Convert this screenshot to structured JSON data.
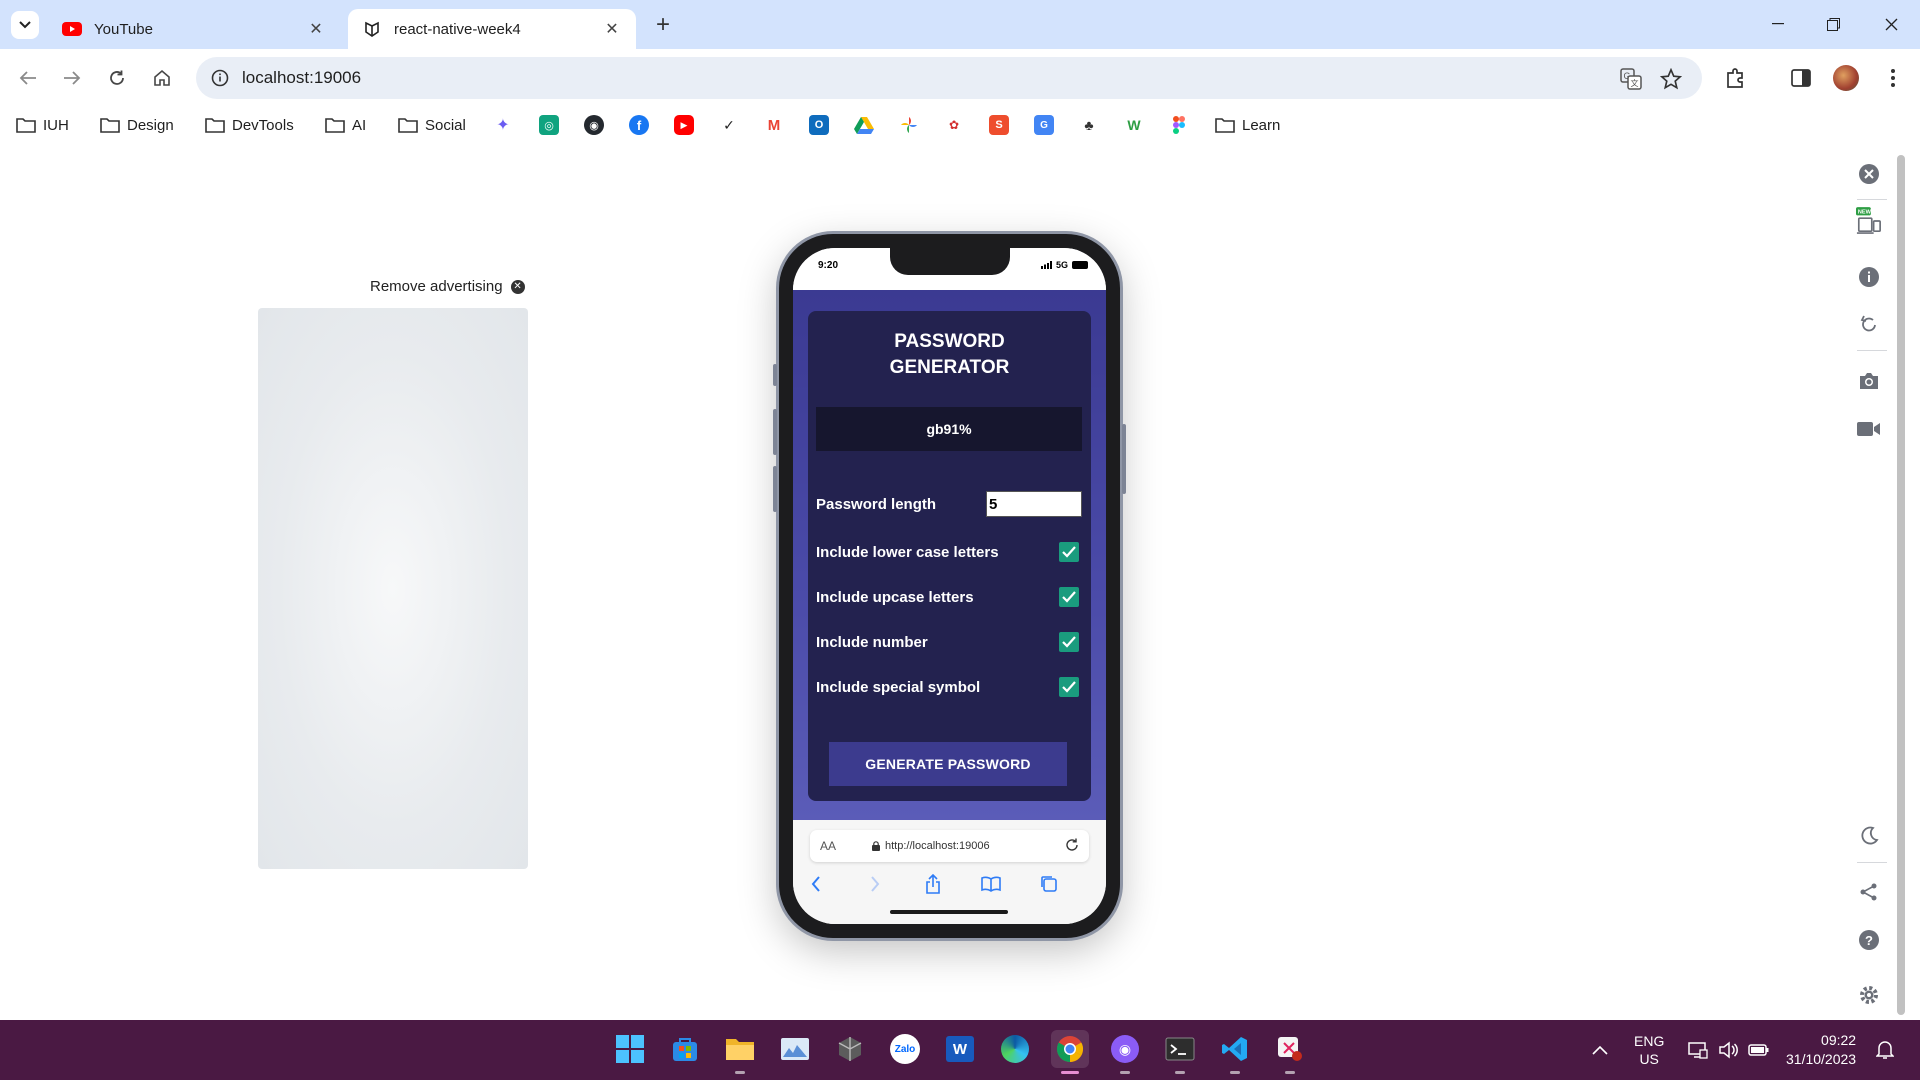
{
  "browser": {
    "tabs": [
      {
        "title": "YouTube",
        "favicon": "youtube-icon",
        "active": false
      },
      {
        "title": "react-native-week4",
        "favicon": "expo-icon",
        "active": true
      }
    ],
    "address": "localhost:19006",
    "bookmarks": [
      {
        "label": "IUH",
        "icon": "folder-icon"
      },
      {
        "label": "Design",
        "icon": "folder-icon"
      },
      {
        "label": "DevTools",
        "icon": "folder-icon"
      },
      {
        "label": "AI",
        "icon": "folder-icon"
      },
      {
        "label": "Social",
        "icon": "folder-icon"
      },
      {
        "label": "Learn",
        "icon": "folder-icon"
      }
    ]
  },
  "page": {
    "ad_label": "Remove advertising"
  },
  "phone": {
    "status_time": "9:20",
    "status_network": "5G",
    "app": {
      "title_line1": "PASSWORD",
      "title_line2": "GENERATOR",
      "password": "gb91%",
      "length_label": "Password length",
      "length_value": "5",
      "options": [
        {
          "label": "Include lower case letters",
          "checked": true
        },
        {
          "label": "Include upcase letters",
          "checked": true
        },
        {
          "label": "Include number",
          "checked": true
        },
        {
          "label": "Include special symbol",
          "checked": true
        }
      ],
      "generate_label": "GENERATE PASSWORD"
    },
    "safari": {
      "aa": "AA",
      "url": "http://localhost:19006"
    }
  },
  "taskbar": {
    "lang_line1": "ENG",
    "lang_line2": "US",
    "time": "09:22",
    "date": "31/10/2023"
  },
  "colors": {
    "tabstrip": "#d3e3fd",
    "app_bg": "#3b3a92",
    "card": "#23224f",
    "checkbox": "#1a9c7e",
    "taskbar": "#4a1943"
  }
}
